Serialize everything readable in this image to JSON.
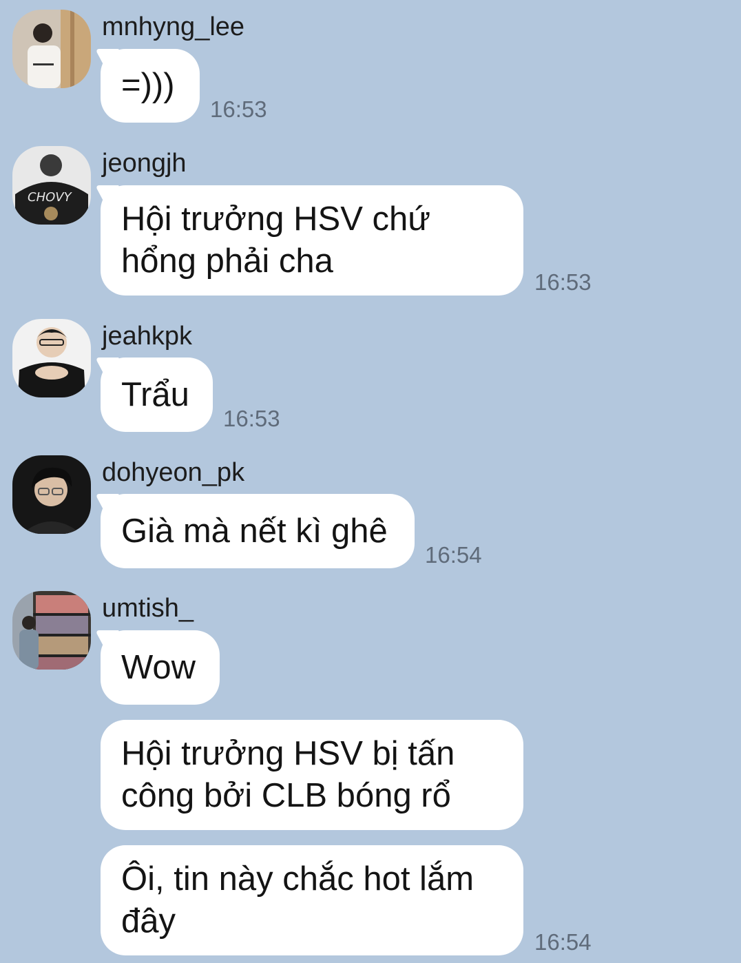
{
  "messages": [
    {
      "username": "mnhyng_lee",
      "text": "=)))",
      "time": "16:53"
    },
    {
      "username": "jeongjh",
      "text": "Hội trưởng HSV chứ\nhổng phải cha",
      "time": "16:53"
    },
    {
      "username": "jeahkpk",
      "text": "Trẩu",
      "time": "16:53"
    },
    {
      "username": "dohyeon_pk",
      "text": "Già mà nết kì ghê",
      "time": "16:54"
    },
    {
      "username": "umtish_",
      "text": "Wow"
    },
    {
      "text": "Hội trưởng HSV bị tấn\ncông bởi CLB bóng rổ"
    },
    {
      "text": "Ôi, tin này chắc hot lắm\nđây",
      "time": "16:54"
    }
  ],
  "colors": {
    "background": "#b3c7dd",
    "bubble": "#ffffff",
    "timestamp": "#5f6b7a"
  }
}
